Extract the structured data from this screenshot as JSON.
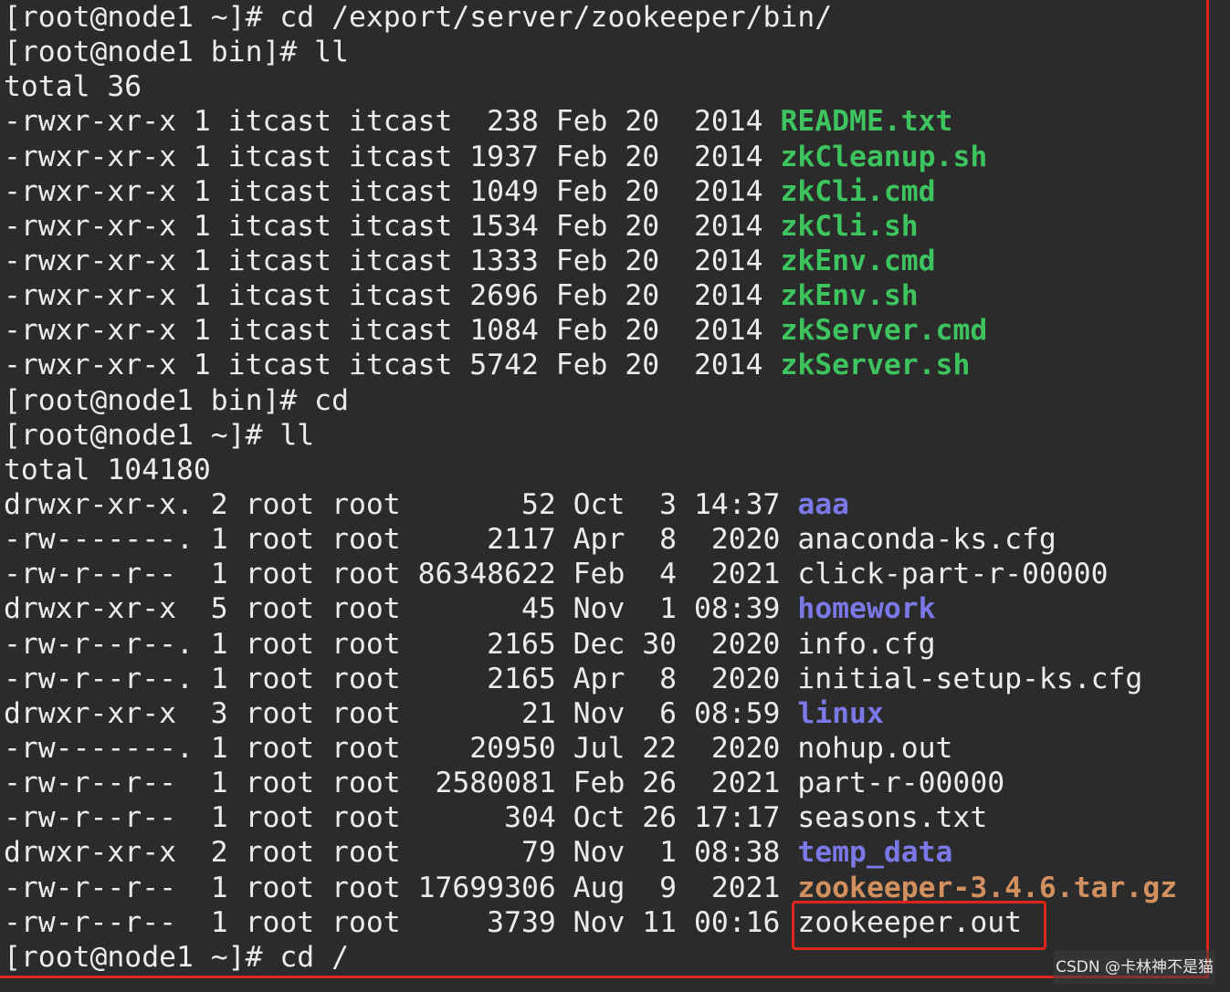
{
  "terminal": {
    "lines": [
      [
        {
          "t": "[root@node1 ~]# cd /export/server/zookeeper/bin/",
          "c": "plain"
        }
      ],
      [
        {
          "t": "[root@node1 bin]# ll",
          "c": "plain"
        }
      ],
      [
        {
          "t": "total 36",
          "c": "plain"
        }
      ],
      [
        {
          "t": "-rwxr-xr-x 1 itcast itcast  238 Feb 20  2014 ",
          "c": "plain"
        },
        {
          "t": "README.txt",
          "c": "exec"
        }
      ],
      [
        {
          "t": "-rwxr-xr-x 1 itcast itcast 1937 Feb 20  2014 ",
          "c": "plain"
        },
        {
          "t": "zkCleanup.sh",
          "c": "exec"
        }
      ],
      [
        {
          "t": "-rwxr-xr-x 1 itcast itcast 1049 Feb 20  2014 ",
          "c": "plain"
        },
        {
          "t": "zkCli.cmd",
          "c": "exec"
        }
      ],
      [
        {
          "t": "-rwxr-xr-x 1 itcast itcast 1534 Feb 20  2014 ",
          "c": "plain"
        },
        {
          "t": "zkCli.sh",
          "c": "exec"
        }
      ],
      [
        {
          "t": "-rwxr-xr-x 1 itcast itcast 1333 Feb 20  2014 ",
          "c": "plain"
        },
        {
          "t": "zkEnv.cmd",
          "c": "exec"
        }
      ],
      [
        {
          "t": "-rwxr-xr-x 1 itcast itcast 2696 Feb 20  2014 ",
          "c": "plain"
        },
        {
          "t": "zkEnv.sh",
          "c": "exec"
        }
      ],
      [
        {
          "t": "-rwxr-xr-x 1 itcast itcast 1084 Feb 20  2014 ",
          "c": "plain"
        },
        {
          "t": "zkServer.cmd",
          "c": "exec"
        }
      ],
      [
        {
          "t": "-rwxr-xr-x 1 itcast itcast 5742 Feb 20  2014 ",
          "c": "plain"
        },
        {
          "t": "zkServer.sh",
          "c": "exec"
        }
      ],
      [
        {
          "t": "[root@node1 bin]# cd",
          "c": "plain"
        }
      ],
      [
        {
          "t": "[root@node1 ~]# ll",
          "c": "plain"
        }
      ],
      [
        {
          "t": "total 104180",
          "c": "plain"
        }
      ],
      [
        {
          "t": "drwxr-xr-x. 2 root root       52 Oct  3 14:37 ",
          "c": "plain"
        },
        {
          "t": "aaa",
          "c": "dir"
        }
      ],
      [
        {
          "t": "-rw-------. 1 root root     2117 Apr  8  2020 ",
          "c": "plain"
        },
        {
          "t": "anaconda-ks.cfg",
          "c": "plain"
        }
      ],
      [
        {
          "t": "-rw-r--r--  1 root root 86348622 Feb  4  2021 ",
          "c": "plain"
        },
        {
          "t": "click-part-r-00000",
          "c": "plain"
        }
      ],
      [
        {
          "t": "drwxr-xr-x  5 root root       45 Nov  1 08:39 ",
          "c": "plain"
        },
        {
          "t": "homework",
          "c": "dir"
        }
      ],
      [
        {
          "t": "-rw-r--r--. 1 root root     2165 Dec 30  2020 ",
          "c": "plain"
        },
        {
          "t": "info.cfg",
          "c": "plain"
        }
      ],
      [
        {
          "t": "-rw-r--r--. 1 root root     2165 Apr  8  2020 ",
          "c": "plain"
        },
        {
          "t": "initial-setup-ks.cfg",
          "c": "plain"
        }
      ],
      [
        {
          "t": "drwxr-xr-x  3 root root       21 Nov  6 08:59 ",
          "c": "plain"
        },
        {
          "t": "linux",
          "c": "dir"
        }
      ],
      [
        {
          "t": "-rw-------. 1 root root    20950 Jul 22  2020 ",
          "c": "plain"
        },
        {
          "t": "nohup.out",
          "c": "plain"
        }
      ],
      [
        {
          "t": "-rw-r--r--  1 root root  2580081 Feb 26  2021 ",
          "c": "plain"
        },
        {
          "t": "part-r-00000",
          "c": "plain"
        }
      ],
      [
        {
          "t": "-rw-r--r--  1 root root      304 Oct 26 17:17 ",
          "c": "plain"
        },
        {
          "t": "seasons.txt",
          "c": "plain"
        }
      ],
      [
        {
          "t": "drwxr-xr-x  2 root root       79 Nov  1 08:38 ",
          "c": "plain"
        },
        {
          "t": "temp_data",
          "c": "dir"
        }
      ],
      [
        {
          "t": "-rw-r--r--  1 root root 17699306 Aug  9  2021 ",
          "c": "plain"
        },
        {
          "t": "zookeeper-3.4.6.tar.gz",
          "c": "archive"
        }
      ],
      [
        {
          "t": "-rw-r--r--  1 root root     3739 Nov 11 00:16 ",
          "c": "plain"
        },
        {
          "t": "zookeeper.out",
          "c": "plain"
        }
      ],
      [
        {
          "t": "[root@node1 ~]# cd /",
          "c": "plain"
        }
      ]
    ]
  },
  "watermark": "CSDN @卡林神不是猫",
  "colors": {
    "background": "#2b2b2b",
    "text": "#ececec",
    "executable": "#3ec45e",
    "directory": "#7b78e8",
    "archive": "#d2905f",
    "annotation": "#e0251c"
  }
}
